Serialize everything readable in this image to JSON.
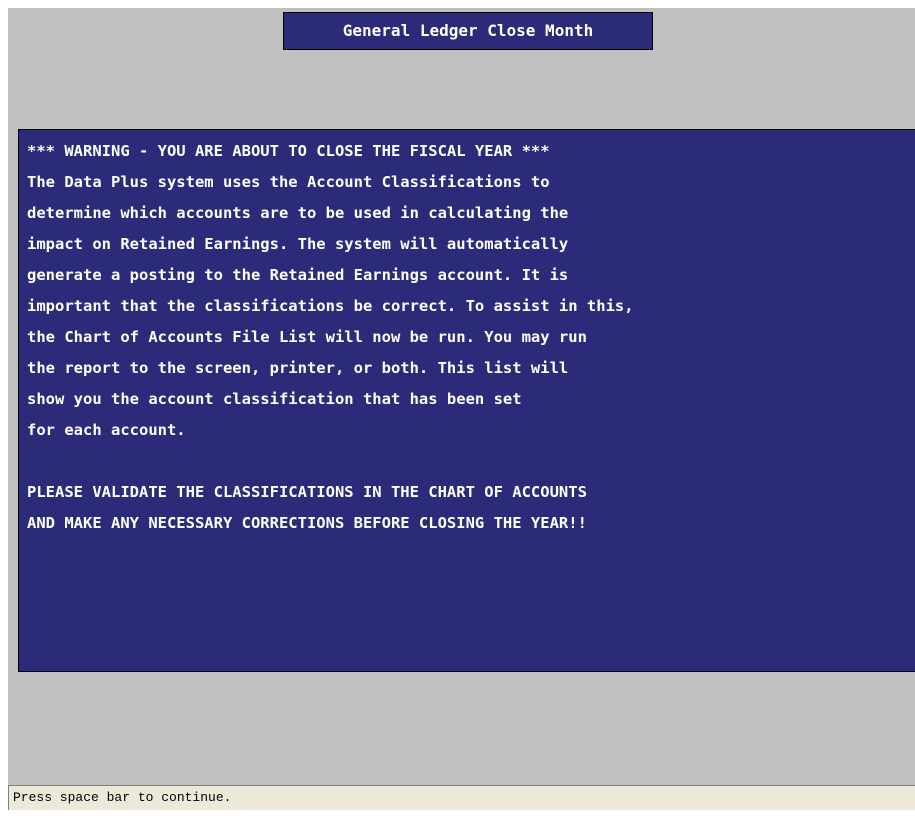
{
  "window": {
    "title": "General Ledger Close Month"
  },
  "warning": {
    "lines": [
      "*** WARNING - YOU ARE ABOUT TO CLOSE THE FISCAL YEAR ***",
      "The Data Plus system uses the Account Classifications to",
      "determine which accounts are to be used in calculating the",
      "impact on Retained Earnings. The system will automatically",
      "generate a posting to the Retained Earnings account. It is",
      "important that the classifications be correct. To assist in this,",
      "the Chart of Accounts File List will now be run. You may run",
      "the report to the screen, printer, or both. This list will",
      "show you the account classification that has been set",
      "for each account.",
      "",
      "PLEASE VALIDATE THE CLASSIFICATIONS IN THE CHART OF ACCOUNTS",
      "AND MAKE ANY NECESSARY CORRECTIONS BEFORE CLOSING THE YEAR!!"
    ]
  },
  "status_bar": {
    "prompt": "Press space bar to continue."
  },
  "colors": {
    "panel_background": "#2b2b7a",
    "screen_background": "#c0c0c0",
    "text": "#ffffff",
    "status_background": "#ece9d8"
  }
}
